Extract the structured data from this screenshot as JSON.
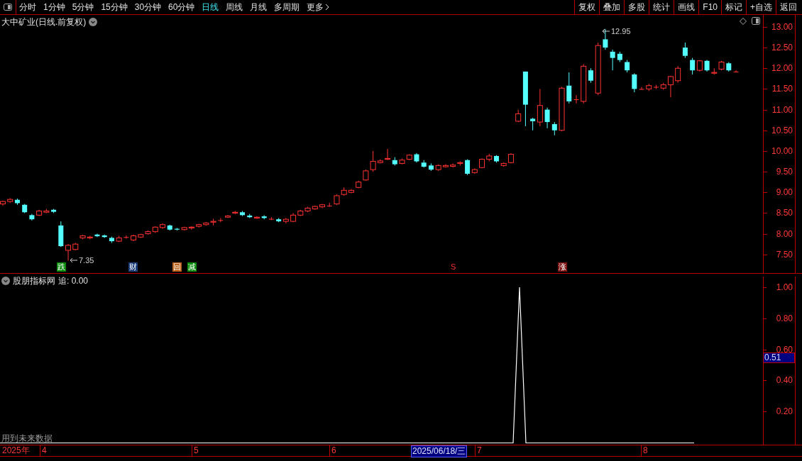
{
  "toolbar": {
    "periods": [
      {
        "label": "分时",
        "selected": false
      },
      {
        "label": "1分钟",
        "selected": false
      },
      {
        "label": "5分钟",
        "selected": false
      },
      {
        "label": "15分钟",
        "selected": false
      },
      {
        "label": "30分钟",
        "selected": false
      },
      {
        "label": "60分钟",
        "selected": false
      },
      {
        "label": "日线",
        "selected": true
      },
      {
        "label": "周线",
        "selected": false
      },
      {
        "label": "月线",
        "selected": false
      },
      {
        "label": "多周期",
        "selected": false
      },
      {
        "label": "更多",
        "selected": false
      }
    ],
    "actions": [
      "复权",
      "叠加",
      "多股",
      "统计",
      "画线",
      "F10",
      "标记",
      "+自选",
      "返回"
    ]
  },
  "main_pane": {
    "title": "大中矿业(日线.前复权)",
    "price_labels": [
      "12.95",
      "7.35"
    ],
    "signals": [
      {
        "text": "跌",
        "kind": "tag",
        "color": "#0a8a0a"
      },
      {
        "text": "财",
        "kind": "tag",
        "color": "#1c3d7a"
      },
      {
        "text": "回",
        "kind": "tag",
        "color": "#b8601c"
      },
      {
        "text": "减",
        "kind": "tag",
        "color": "#0a8a0a"
      },
      {
        "text": "S",
        "kind": "text",
        "color": "#ff3030"
      },
      {
        "text": "涨",
        "kind": "tag",
        "color": "#7a1010"
      }
    ],
    "chart_data": {
      "type": "candlestick",
      "ohlc": [
        [
          8.72,
          8.8,
          8.68,
          8.78
        ],
        [
          8.78,
          8.86,
          8.75,
          8.83
        ],
        [
          8.82,
          8.85,
          8.7,
          8.74
        ],
        [
          8.7,
          8.72,
          8.5,
          8.52
        ],
        [
          8.45,
          8.48,
          8.32,
          8.35
        ],
        [
          8.45,
          8.58,
          8.43,
          8.55
        ],
        [
          8.52,
          8.6,
          8.5,
          8.55
        ],
        [
          8.58,
          8.6,
          8.5,
          8.53
        ],
        [
          8.2,
          8.3,
          7.68,
          7.7
        ],
        [
          7.6,
          7.75,
          7.35,
          7.72
        ],
        [
          7.62,
          7.78,
          7.6,
          7.75
        ],
        [
          7.9,
          7.97,
          7.87,
          7.95
        ],
        [
          7.9,
          7.95,
          7.87,
          7.92
        ],
        [
          7.98,
          8.0,
          7.92,
          7.94
        ],
        [
          7.96,
          7.98,
          7.9,
          7.92
        ],
        [
          7.9,
          7.93,
          7.78,
          7.82
        ],
        [
          7.82,
          7.95,
          7.8,
          7.9
        ],
        [
          7.92,
          7.96,
          7.88,
          7.92
        ],
        [
          7.85,
          7.98,
          7.82,
          7.95
        ],
        [
          7.92,
          8.0,
          7.9,
          7.98
        ],
        [
          8.0,
          8.08,
          7.98,
          8.05
        ],
        [
          8.05,
          8.18,
          8.02,
          8.16
        ],
        [
          8.15,
          8.25,
          8.12,
          8.22
        ],
        [
          8.2,
          8.22,
          8.08,
          8.1
        ],
        [
          8.12,
          8.14,
          8.08,
          8.1
        ],
        [
          8.1,
          8.17,
          8.08,
          8.15
        ],
        [
          8.14,
          8.18,
          8.1,
          8.16
        ],
        [
          8.18,
          8.24,
          8.15,
          8.22
        ],
        [
          8.22,
          8.28,
          8.2,
          8.26
        ],
        [
          8.28,
          8.36,
          8.2,
          8.3
        ],
        [
          8.32,
          8.38,
          8.28,
          8.33
        ],
        [
          8.4,
          8.45,
          8.38,
          8.43
        ],
        [
          8.5,
          8.55,
          8.48,
          8.52
        ],
        [
          8.52,
          8.55,
          8.43,
          8.45
        ],
        [
          8.44,
          8.48,
          8.38,
          8.4
        ],
        [
          8.38,
          8.42,
          8.36,
          8.4
        ],
        [
          8.42,
          8.45,
          8.35,
          8.38
        ],
        [
          8.36,
          8.4,
          8.33,
          8.36
        ],
        [
          8.35,
          8.38,
          8.28,
          8.3
        ],
        [
          8.3,
          8.38,
          8.25,
          8.35
        ],
        [
          8.3,
          8.5,
          8.28,
          8.45
        ],
        [
          8.45,
          8.58,
          8.43,
          8.55
        ],
        [
          8.55,
          8.65,
          8.52,
          8.62
        ],
        [
          8.6,
          8.68,
          8.58,
          8.66
        ],
        [
          8.65,
          8.72,
          8.62,
          8.7
        ],
        [
          8.68,
          8.75,
          8.65,
          8.68
        ],
        [
          8.72,
          8.95,
          8.7,
          8.92
        ],
        [
          8.95,
          9.12,
          8.92,
          9.05
        ],
        [
          9.0,
          9.08,
          8.98,
          9.05
        ],
        [
          9.12,
          9.28,
          9.1,
          9.25
        ],
        [
          9.3,
          9.55,
          9.28,
          9.52
        ],
        [
          9.55,
          10.0,
          9.5,
          9.75
        ],
        [
          9.72,
          9.8,
          9.7,
          9.76
        ],
        [
          9.8,
          10.05,
          9.78,
          9.82
        ],
        [
          9.78,
          9.85,
          9.65,
          9.68
        ],
        [
          9.7,
          9.82,
          9.68,
          9.78
        ],
        [
          9.8,
          9.92,
          9.78,
          9.9
        ],
        [
          9.92,
          9.95,
          9.72,
          9.75
        ],
        [
          9.72,
          9.78,
          9.6,
          9.62
        ],
        [
          9.65,
          9.7,
          9.52,
          9.55
        ],
        [
          9.55,
          9.68,
          9.52,
          9.65
        ],
        [
          9.62,
          9.68,
          9.6,
          9.65
        ],
        [
          9.63,
          9.7,
          9.6,
          9.66
        ],
        [
          9.7,
          9.75,
          9.65,
          9.72
        ],
        [
          9.78,
          9.8,
          9.42,
          9.45
        ],
        [
          9.48,
          9.58,
          9.45,
          9.55
        ],
        [
          9.6,
          9.82,
          9.58,
          9.8
        ],
        [
          9.8,
          9.93,
          9.75,
          9.88
        ],
        [
          9.88,
          9.9,
          9.72,
          9.75
        ],
        [
          9.65,
          9.72,
          9.62,
          9.7
        ],
        [
          9.72,
          9.95,
          9.7,
          9.92
        ],
        [
          10.72,
          11.0,
          10.7,
          10.9
        ],
        [
          11.92,
          11.92,
          10.6,
          11.12
        ],
        [
          10.78,
          10.8,
          10.5,
          10.72
        ],
        [
          10.7,
          11.5,
          10.6,
          11.1
        ],
        [
          11.0,
          11.05,
          10.55,
          10.7
        ],
        [
          10.65,
          10.7,
          10.38,
          10.5
        ],
        [
          10.5,
          11.55,
          10.48,
          11.52
        ],
        [
          11.58,
          11.9,
          11.15,
          11.2
        ],
        [
          11.25,
          11.35,
          11.15,
          11.25
        ],
        [
          11.2,
          12.1,
          11.15,
          12.05
        ],
        [
          11.95,
          12.0,
          11.65,
          11.7
        ],
        [
          11.4,
          12.62,
          11.35,
          12.55
        ],
        [
          12.7,
          12.95,
          12.45,
          12.5
        ],
        [
          12.4,
          12.45,
          11.95,
          12.25
        ],
        [
          12.35,
          12.4,
          12.15,
          12.2
        ],
        [
          12.15,
          12.2,
          11.9,
          11.95
        ],
        [
          11.85,
          11.88,
          11.42,
          11.5
        ],
        [
          11.5,
          11.55,
          11.48,
          11.5
        ],
        [
          11.5,
          11.62,
          11.45,
          11.58
        ],
        [
          11.55,
          11.6,
          11.5,
          11.55
        ],
        [
          11.52,
          11.65,
          11.48,
          11.6
        ],
        [
          11.6,
          11.82,
          11.3,
          11.8
        ],
        [
          11.7,
          12.05,
          11.65,
          12.0
        ],
        [
          12.5,
          12.62,
          12.25,
          12.3
        ],
        [
          12.2,
          12.25,
          11.85,
          11.95
        ],
        [
          11.95,
          12.2,
          11.92,
          12.18
        ],
        [
          12.18,
          12.2,
          11.92,
          11.95
        ],
        [
          11.88,
          12.0,
          11.85,
          11.9
        ],
        [
          11.98,
          12.18,
          11.95,
          12.15
        ],
        [
          12.12,
          12.15,
          11.92,
          11.95
        ],
        [
          11.92,
          11.95,
          11.9,
          11.92
        ]
      ],
      "ylim": [
        7.05,
        13.29
      ],
      "yticks": [
        {
          "value": 13,
          "label": "13.00"
        },
        {
          "value": 12.5,
          "label": "12.50"
        },
        {
          "value": 12,
          "label": "12.00"
        },
        {
          "value": 11.5,
          "label": "11.50"
        },
        {
          "value": 11,
          "label": "11.00"
        },
        {
          "value": 10.5,
          "label": "10.50"
        },
        {
          "value": 10,
          "label": "10.00"
        },
        {
          "value": 9.5,
          "label": "9.50"
        },
        {
          "value": 9,
          "label": "9.00"
        },
        {
          "value": 8.5,
          "label": "8.50"
        },
        {
          "value": 8,
          "label": "8.00"
        },
        {
          "value": 7.5,
          "label": "7.50"
        }
      ]
    }
  },
  "indicator_pane": {
    "title": "股朋指标网",
    "reading": "追: 0.00",
    "y_axis": [
      "1.00",
      "0.80",
      "0.60",
      "0.40",
      "0.20"
    ],
    "cursor_value": "0.51",
    "note": "用到未来数据"
  },
  "date_axis": {
    "year": "2025年",
    "months": [
      "4",
      "5",
      "6",
      "7",
      "8"
    ],
    "cursor_date": "2025/06/18/三"
  }
}
